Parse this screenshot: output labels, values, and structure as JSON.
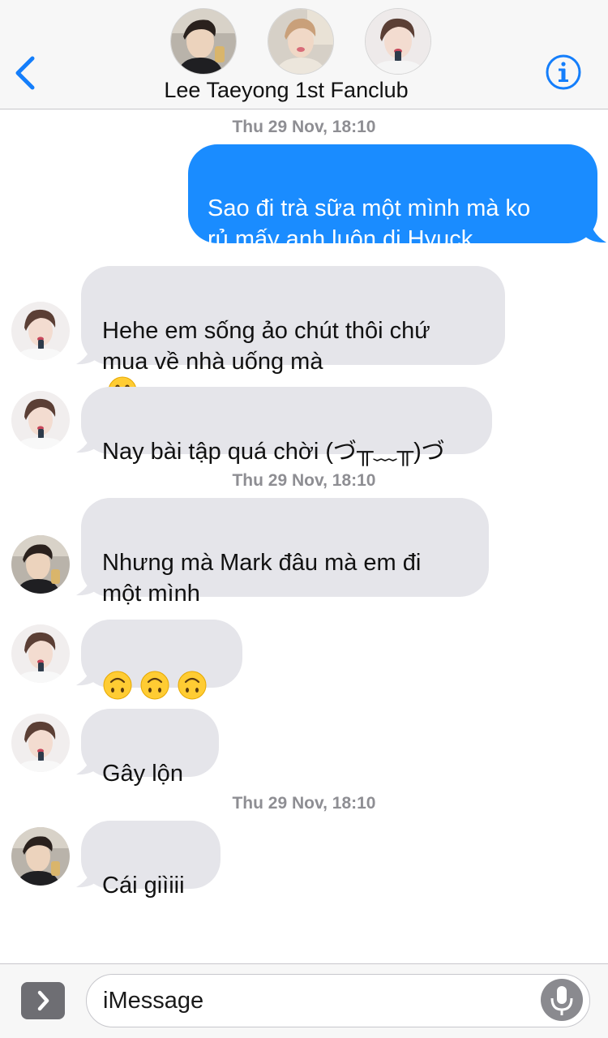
{
  "header": {
    "title": "Lee Taeyong 1st Fanclub",
    "back_icon": "chevron-left-icon",
    "info_icon": "info-icon"
  },
  "messages": [
    {
      "type": "timestamp",
      "text": "Thu 29 Nov, 18:10"
    },
    {
      "type": "sent",
      "text": "Sao đi trà sữa một mình mà ko\nrủ mấy anh luôn dị Hyuck"
    },
    {
      "type": "received",
      "text": "Hehe em sống ảo chút thôi chứ\nmua về nhà uống mà",
      "emoji": "grinning-face-icon"
    },
    {
      "type": "received",
      "text": "Nay bài tập quá chời (づ╥﹏╥)づ"
    },
    {
      "type": "timestamp",
      "text": "Thu 29 Nov, 18:10"
    },
    {
      "type": "received",
      "text": "Nhưng mà Mark đâu mà em đi\nmột mình"
    },
    {
      "type": "received",
      "text": "",
      "emoji": "upside-down-face-icon x3"
    },
    {
      "type": "received",
      "text": "Gây lộn"
    },
    {
      "type": "timestamp",
      "text": "Thu 29 Nov, 18:10"
    },
    {
      "type": "received",
      "text": "Cái giìiii"
    }
  ],
  "compose": {
    "placeholder": "iMessage",
    "apps_icon": "chevron-right-icon",
    "mic_icon": "microphone-icon"
  },
  "colors": {
    "sent_bubble": "#1a8cff",
    "received_bubble": "#e5e5ea",
    "accent": "#147efb",
    "timestamp": "#8e8e93"
  }
}
